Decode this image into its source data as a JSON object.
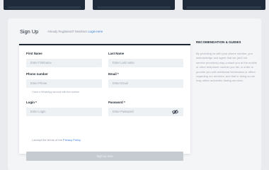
{
  "header": {
    "title": "Sign Up",
    "registered_text": "Already Registered? Members",
    "login_link": "Login Here"
  },
  "form": {
    "first_name": {
      "label": "First Name",
      "placeholder": "Enter Firstname"
    },
    "last_name": {
      "label": "Last Name",
      "placeholder": "Enter Last name"
    },
    "phone": {
      "label": "Phone number",
      "placeholder": "Enter Phone",
      "note": "I have a WhatsApp account with this number"
    },
    "email": {
      "label": "Email *",
      "placeholder": "Enter Email"
    },
    "login": {
      "label": "Login *",
      "placeholder": "Enter Login"
    },
    "password": {
      "label": "Password *",
      "placeholder": "Enter Password",
      "toggle_icon": "eye-off-icon"
    },
    "terms_text": "I accept the terms of the",
    "terms_link": "Privacy Policy",
    "submit_label": "Sign up now"
  },
  "sidebar": {
    "title": "RECOMENDATION & GUIDES",
    "text": "By providing us with your phone number, you acknowledge and agree that we (and our service providers) may contact you at the mobile or other telephone number you list, in order to provide you with additional information or offers regarding our services, and that in doing so we may utilize automatic dialing services."
  },
  "colors": {
    "page_bg": "#f4f5f7",
    "card_accent": "#1d2633",
    "link": "#3d7fd6",
    "button_disabled": "#c6cbd1"
  }
}
